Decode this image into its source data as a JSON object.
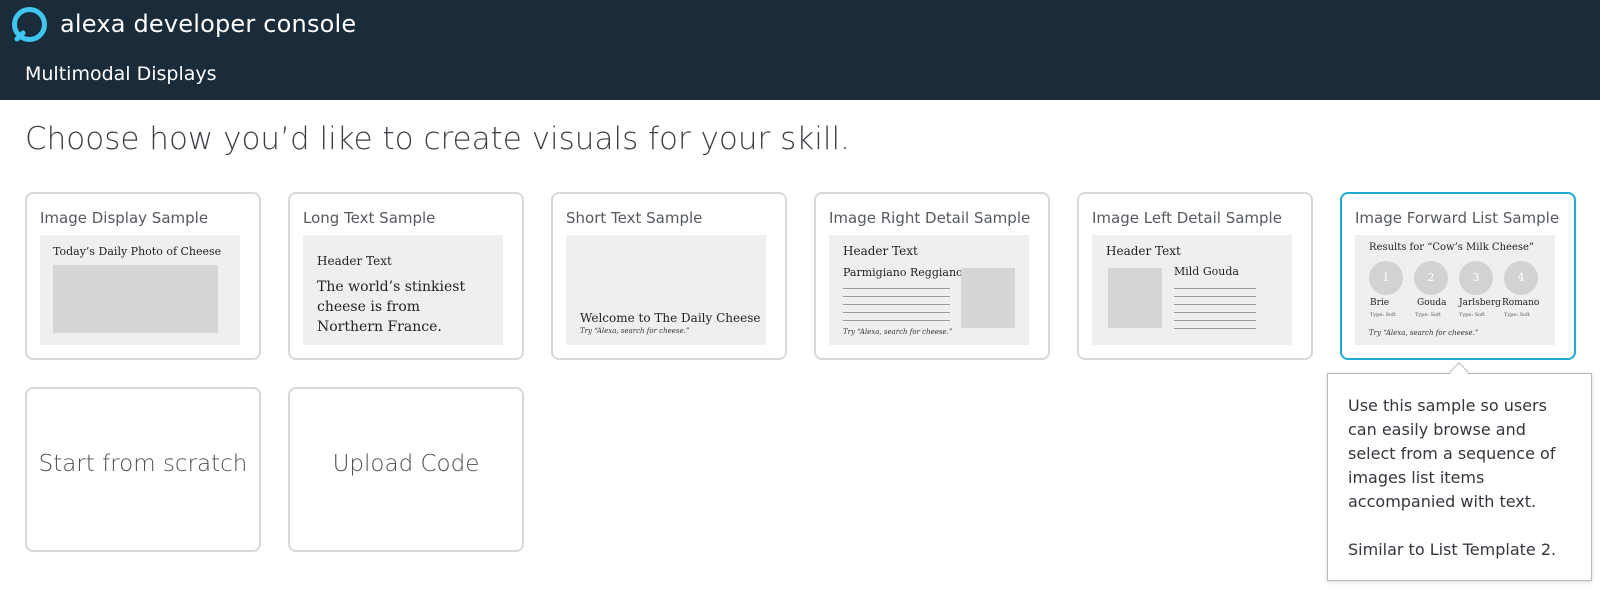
{
  "header": {
    "brand": "alexa developer console",
    "subtitle": "Multimodal Displays",
    "brand_color": "#1a2b3a",
    "logo_color": "#3ec6f1"
  },
  "page_title": "Choose how you’d like to create visuals for your skill.",
  "templates": [
    {
      "title": "Image Display Sample",
      "preview": {
        "caption": "Today’s Daily Photo of Cheese"
      }
    },
    {
      "title": "Long Text Sample",
      "preview": {
        "header": "Header Text",
        "body": "The world’s stinkiest cheese is from Northern France."
      }
    },
    {
      "title": "Short Text Sample",
      "preview": {
        "primary": "Welcome to The Daily Cheese",
        "hint": "Try “Alexa, search for cheese.”"
      }
    },
    {
      "title": "Image Right Detail Sample",
      "preview": {
        "header": "Header Text",
        "item": "Parmigiano Reggiano",
        "hint": "Try “Alexa, search for cheese.”"
      }
    },
    {
      "title": "Image Left Detail Sample",
      "preview": {
        "header": "Header Text",
        "item": "Mild Gouda"
      }
    },
    {
      "title": "Image Forward List Sample",
      "selected": true,
      "preview": {
        "header": "Results for “Cow’s Milk Cheese”",
        "items": [
          {
            "number": "1",
            "name": "Brie",
            "type": "Type: Soft"
          },
          {
            "number": "2",
            "name": "Gouda",
            "type": "Type: Soft"
          },
          {
            "number": "3",
            "name": "Jarlsberg",
            "type": "Type: Soft"
          },
          {
            "number": "4",
            "name": "Romano",
            "type": "Type: Soft"
          }
        ],
        "hint": "Try “Alexa, search for cheese.”"
      }
    }
  ],
  "options": [
    {
      "label": "Start from scratch"
    },
    {
      "label": "Upload Code"
    }
  ],
  "tooltip": {
    "description": "Use this sample so users can easily browse and select from a sequence of images list items accompanied with text.",
    "note": "Similar to List Template 2."
  },
  "accent_color": "#1fa9d9"
}
